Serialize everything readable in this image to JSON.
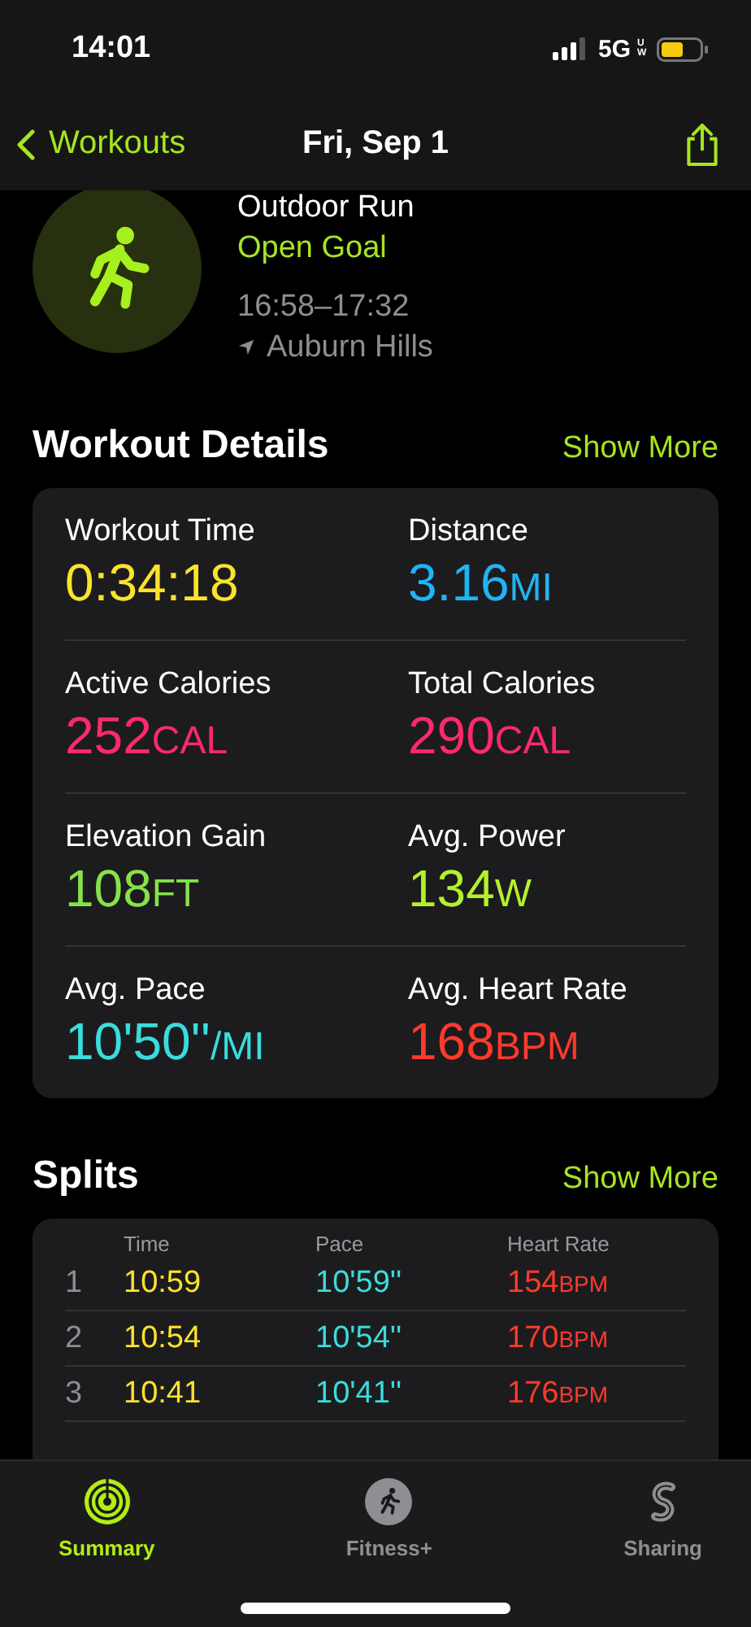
{
  "status_bar": {
    "time": "14:01",
    "network": "5G",
    "network_badge": "UW"
  },
  "nav": {
    "back_label": "Workouts",
    "title": "Fri, Sep 1"
  },
  "workout": {
    "name": "Outdoor Run",
    "goal": "Open Goal",
    "time_range": "16:58–17:32",
    "location": "Auburn Hills"
  },
  "details": {
    "title": "Workout Details",
    "action": "Show More",
    "metrics": [
      {
        "label": "Workout Time",
        "value": "0:34:18",
        "color": "#fbe32c"
      },
      {
        "label": "Distance",
        "value": "3.16",
        "unit": "MI",
        "color": "#21b4f2"
      },
      {
        "label": "Active Calories",
        "value": "252",
        "unit": "CAL",
        "color": "#fb2a68"
      },
      {
        "label": "Total Calories",
        "value": "290",
        "unit": "CAL",
        "color": "#fb2a68"
      },
      {
        "label": "Elevation Gain",
        "value": "108",
        "unit": "FT",
        "color": "#86e24b"
      },
      {
        "label": "Avg. Power",
        "value": "134",
        "unit": "W",
        "color": "#b4f02c"
      },
      {
        "label": "Avg. Pace",
        "value": "10'50''",
        "unit": "/MI",
        "color": "#3adcdc"
      },
      {
        "label": "Avg. Heart Rate",
        "value": "168",
        "unit": "BPM",
        "color": "#fd3a2d"
      }
    ]
  },
  "splits": {
    "title": "Splits",
    "action": "Show More",
    "columns": [
      "Time",
      "Pace",
      "Heart Rate"
    ],
    "rows": [
      {
        "index": "1",
        "time": "10:59",
        "pace": "10'59''",
        "heart_rate": "154",
        "unit": "BPM"
      },
      {
        "index": "2",
        "time": "10:54",
        "pace": "10'54''",
        "heart_rate": "170",
        "unit": "BPM"
      },
      {
        "index": "3",
        "time": "10:41",
        "pace": "10'41''",
        "heart_rate": "176",
        "unit": "BPM"
      }
    ]
  },
  "tab_bar": [
    {
      "label": "Summary",
      "kind": "rings",
      "selected": true
    },
    {
      "label": "Fitness+",
      "kind": "runner",
      "selected": false
    },
    {
      "label": "Sharing",
      "kind": "sharing",
      "selected": false
    }
  ]
}
